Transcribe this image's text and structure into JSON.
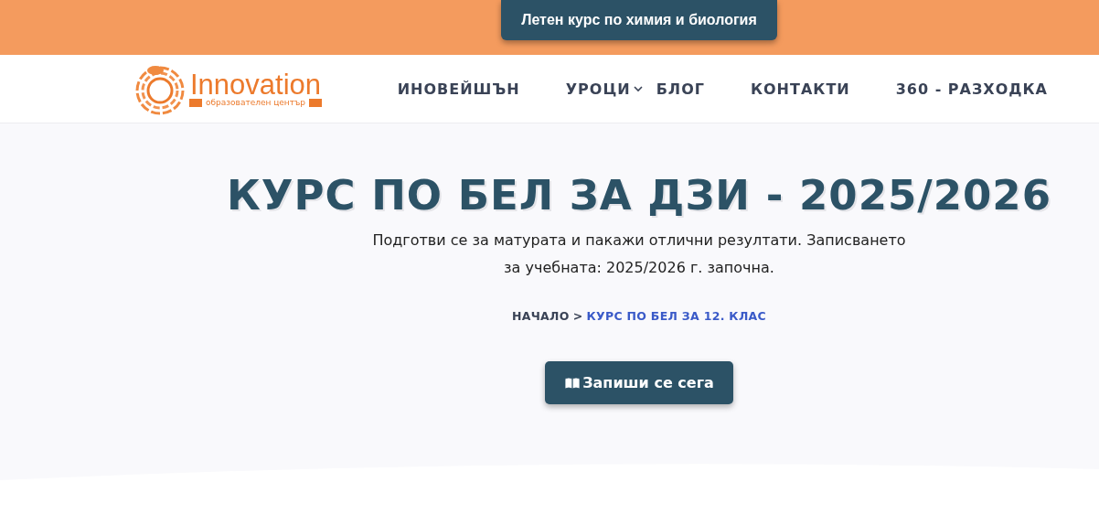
{
  "top_bar": {
    "button": "Летен курс по химия и биология"
  },
  "logo": {
    "name": "Innovation",
    "tagline": "образователен център"
  },
  "nav": [
    {
      "label": "ИНОВЕЙШЪН",
      "has_dropdown": false
    },
    {
      "label": "УРОЦИ",
      "has_dropdown": true
    },
    {
      "label": "БЛОГ",
      "has_dropdown": false
    },
    {
      "label": "КОНТАКТИ",
      "has_dropdown": false
    },
    {
      "label": "360 - РАЗХОДКА",
      "has_dropdown": false
    }
  ],
  "hero": {
    "title": "КУРС ПО БЕЛ ЗА ДЗИ - 2025/2026",
    "subtitle": "Подготви се за матурата и пакажи отлични резултати. Записването за учебната: 2025/2026 г. започна.",
    "breadcrumb": {
      "home": "НАЧАЛО",
      "separator": ">",
      "current": "КУРС ПО БЕЛ ЗА 12. КЛАС"
    },
    "cta": "Запиши се сега"
  }
}
